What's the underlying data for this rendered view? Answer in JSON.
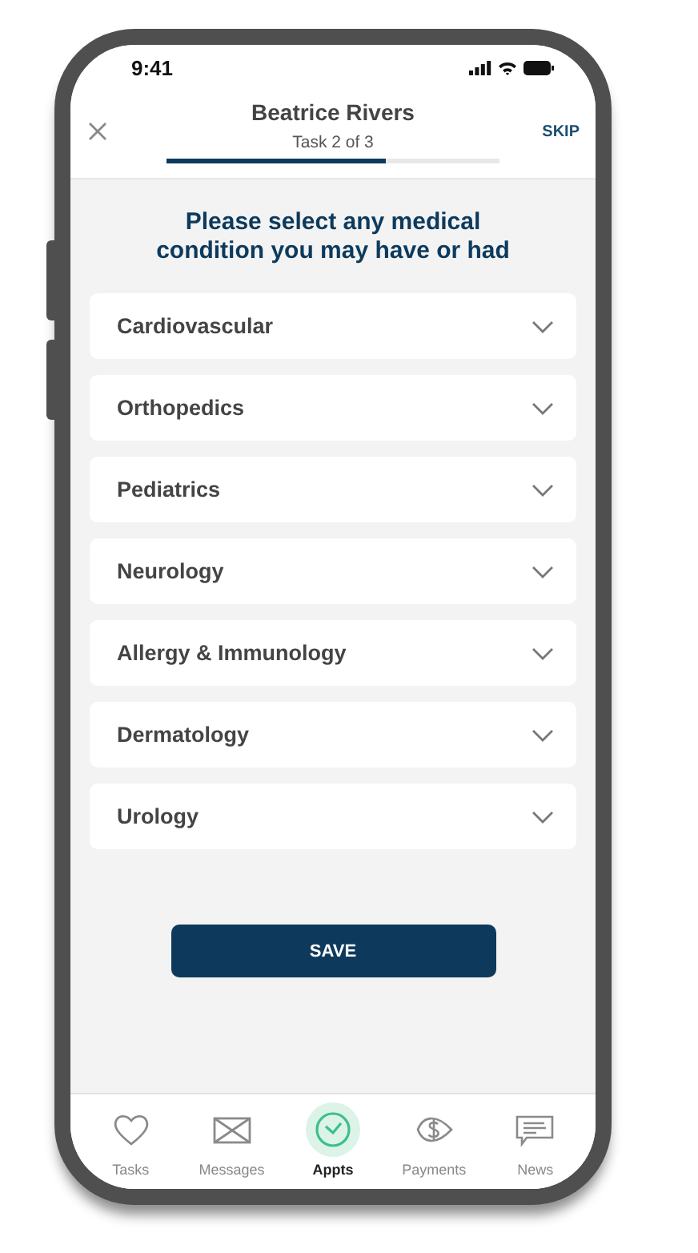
{
  "status_bar": {
    "time": "9:41"
  },
  "header": {
    "title": "Beatrice Rivers",
    "subtitle": "Task 2 of 3",
    "skip": "SKIP",
    "progress": {
      "level": 0.66
    }
  },
  "question": "Please select any medical condition you may have or had",
  "categories": [
    {
      "label": "Cardiovascular",
      "expanded": false
    },
    {
      "label": "Orthopedics",
      "expanded": false
    },
    {
      "label": "Pediatrics",
      "expanded": false
    },
    {
      "label": "Neurology",
      "expanded": false
    },
    {
      "label": "Allergy & Immunology",
      "expanded": false
    },
    {
      "label": "Dermatology",
      "expanded": false
    },
    {
      "label": "Urology",
      "expanded": false
    }
  ],
  "save_button": "SAVE",
  "tab_bar": [
    {
      "label": "Tasks",
      "kind": "heart",
      "selected": false
    },
    {
      "label": "Messages",
      "kind": "envelope",
      "selected": false
    },
    {
      "label": "Appts",
      "kind": "clock",
      "selected": true
    },
    {
      "label": "Payments",
      "kind": "coin",
      "selected": false
    },
    {
      "label": "News",
      "kind": "note",
      "selected": false
    }
  ]
}
